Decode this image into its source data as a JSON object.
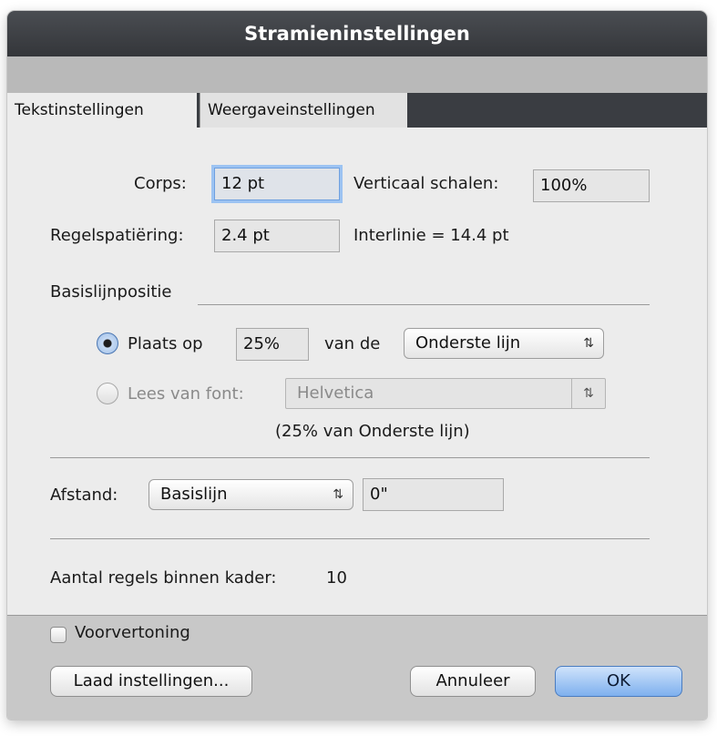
{
  "dialog": {
    "title": "Stramieninstellingen"
  },
  "tabs": [
    {
      "label": "Tekstinstellingen",
      "active": true
    },
    {
      "label": "Weergaveinstellingen",
      "active": false
    }
  ],
  "text_settings": {
    "corps_label": "Corps:",
    "corps_value": "12 pt",
    "vertical_scale_label": "Verticaal schalen:",
    "vertical_scale_value": "100%",
    "line_spacing_label": "Regelspatiëring:",
    "line_spacing_value": "2.4 pt",
    "leading_text": "Interlinie =  14.4 pt"
  },
  "baseline": {
    "section_label": "Basislijnpositie",
    "place_label": "Plaats op",
    "place_value": "25%",
    "of_the_label": "van de",
    "position_selected": "Onderste lijn",
    "read_from_font_label": "Lees van font:",
    "font_selected": "Helvetica",
    "summary": "(25% van Onderste lijn)",
    "selected_option": "place"
  },
  "spacing": {
    "label": "Afstand:",
    "mode_selected": "Basislijn",
    "value": "0\""
  },
  "lines_in_frame": {
    "label": "Aantal regels binnen kader:",
    "value": "10"
  },
  "footer": {
    "preview_label": "Voorvertoning",
    "preview_checked": false,
    "load_settings_label": "Laad instellingen...",
    "cancel_label": "Annuleer",
    "ok_label": "OK"
  },
  "icons": {
    "popup_arrows": "updown-arrows-icon"
  }
}
